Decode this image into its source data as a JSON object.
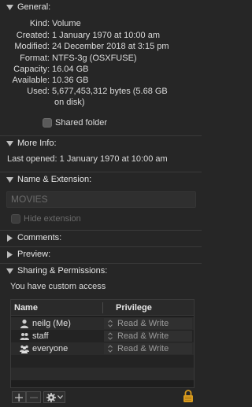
{
  "general": {
    "header": "General:",
    "rows": [
      {
        "key": "Kind:",
        "value": "Volume"
      },
      {
        "key": "Created:",
        "value": "1 January 1970 at 10:00 am"
      },
      {
        "key": "Modified:",
        "value": "24 December 2018 at 3:15 pm"
      },
      {
        "key": "Format:",
        "value": "NTFS-3g (OSXFUSE)"
      },
      {
        "key": "Capacity:",
        "value": "16.04 GB"
      },
      {
        "key": "Available:",
        "value": "10.36 GB"
      },
      {
        "key": "Used:",
        "value": "5,677,453,312 bytes (5.68 GB"
      }
    ],
    "used_continued": "on disk)",
    "shared_folder_label": "Shared folder"
  },
  "more_info": {
    "header": "More Info:",
    "last_opened": "Last opened: 1 January 1970 at 10:00 am"
  },
  "name_extension": {
    "header": "Name & Extension:",
    "name_value": "MOVIES",
    "hide_extension_label": "Hide extension"
  },
  "comments": {
    "header": "Comments:"
  },
  "preview": {
    "header": "Preview:"
  },
  "sharing": {
    "header": "Sharing & Permissions:",
    "access_text": "You have custom access",
    "columns": {
      "name": "Name",
      "privilege": "Privilege"
    },
    "rows": [
      {
        "name": "neilg (Me)",
        "privilege": "Read & Write",
        "icon": "user-icon"
      },
      {
        "name": "staff",
        "privilege": "Read & Write",
        "icon": "group-icon"
      },
      {
        "name": "everyone",
        "privilege": "Read & Write",
        "icon": "everyone-icon"
      }
    ]
  },
  "toolbar": {
    "add_icon": "plus-icon",
    "remove_icon": "minus-icon",
    "action_icon": "gear-icon",
    "lock_icon": "lock-icon"
  },
  "colors": {
    "background": "#262626",
    "lock": "#d79a1e"
  }
}
